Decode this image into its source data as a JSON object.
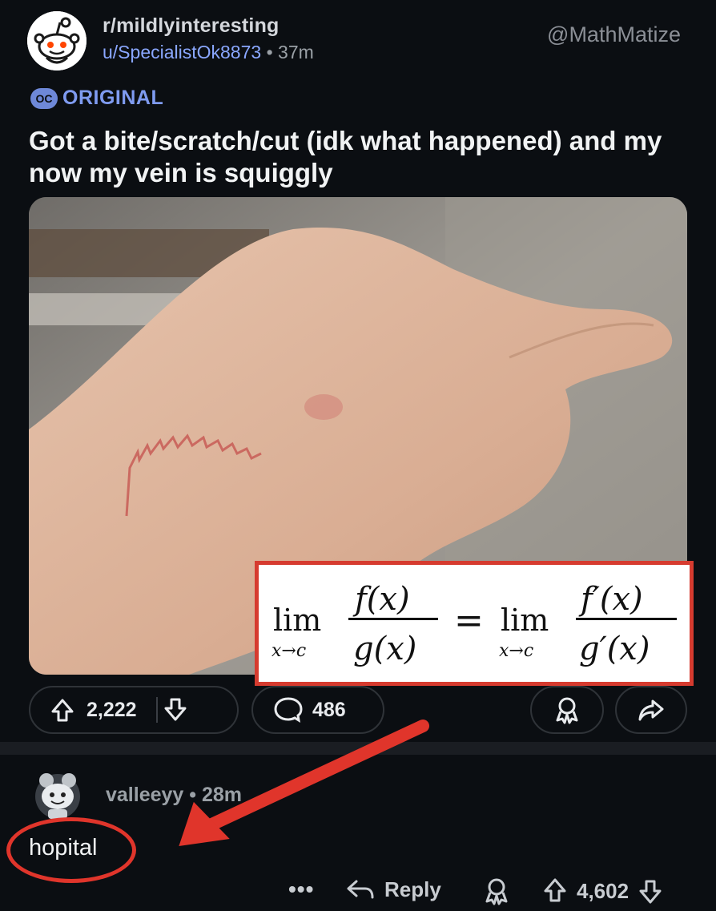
{
  "header": {
    "subreddit": "r/mildlyinteresting",
    "username": "u/SpecialistOk8873",
    "separator": "•",
    "time": "37m",
    "watermark": "@MathMatize"
  },
  "flair": {
    "badge": "OC",
    "label": "ORIGINAL"
  },
  "post": {
    "title": "Got a bite/scratch/cut (idk what happened) and my now my vein is squiggly",
    "upvotes": "2,222",
    "comments": "486"
  },
  "formula": {
    "lim": "lim",
    "sub": "x→c",
    "num_left": "f(x)",
    "den_left": "g(x)",
    "equals": "=",
    "num_right": "f′(x)",
    "den_right": "g′(x)"
  },
  "comment": {
    "username": "valleeyy",
    "separator": "•",
    "time": "28m",
    "text": "hopital",
    "more": "•••",
    "reply_label": "Reply",
    "votes": "4,602"
  },
  "colors": {
    "background": "#0b0e12",
    "accent_link": "#8aa7ff",
    "annotation_red": "#e0352b"
  }
}
